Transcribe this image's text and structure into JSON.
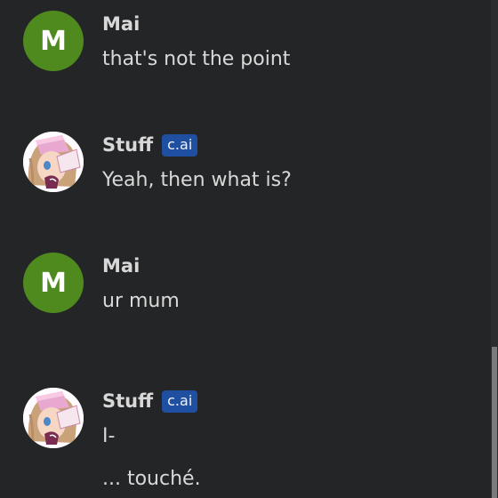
{
  "messages": [
    {
      "author": "Mai",
      "avatar_letter": "M",
      "lines": [
        "that's not the point"
      ]
    },
    {
      "author": "Stuff",
      "badge": "c.ai",
      "lines": [
        "Yeah, then what is?"
      ]
    },
    {
      "author": "Mai",
      "avatar_letter": "M",
      "lines": [
        "ur mum"
      ]
    },
    {
      "author": "Stuff",
      "badge": "c.ai",
      "lines": [
        "I-",
        "... touché."
      ]
    }
  ],
  "colors": {
    "background": "#242526",
    "user_avatar": "#4f8a1f",
    "badge": "#1f4fa0"
  }
}
